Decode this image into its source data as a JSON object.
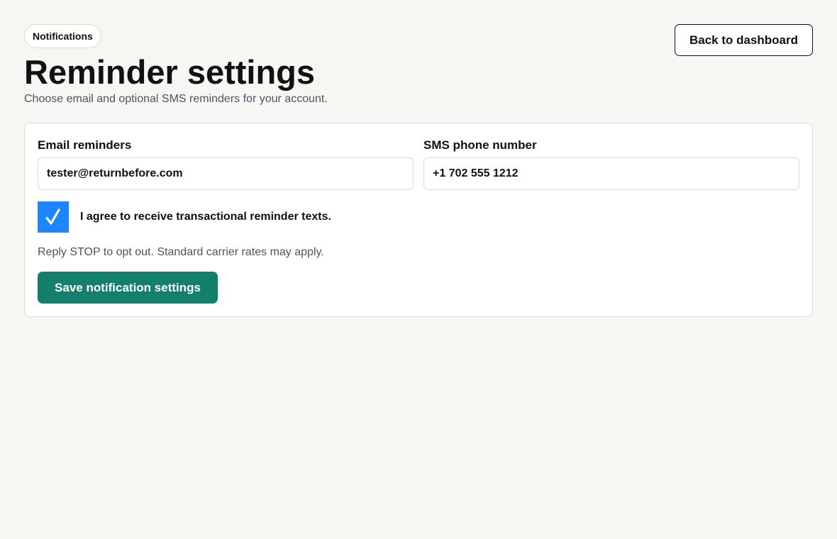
{
  "header": {
    "badge": "Notifications",
    "title": "Reminder settings",
    "subtitle": "Choose email and optional SMS reminders for your account.",
    "back_button": "Back to dashboard"
  },
  "form": {
    "email": {
      "label": "Email reminders",
      "value": "tester@returnbefore.com"
    },
    "phone": {
      "label": "SMS phone number",
      "value": "+1 702 555 1212"
    },
    "consent": {
      "checked": true,
      "label": "I agree to receive transactional reminder texts."
    },
    "help_text": "Reply STOP to opt out. Standard carrier rates may apply.",
    "save_button": "Save notification settings"
  },
  "colors": {
    "page_background": "#f6f6f2",
    "card_background": "#ffffff",
    "primary_button": "#137f6d",
    "checkbox_checked": "#1d86ff",
    "muted_text": "#4d5460"
  },
  "icons": {
    "checkbox": "check-icon"
  }
}
